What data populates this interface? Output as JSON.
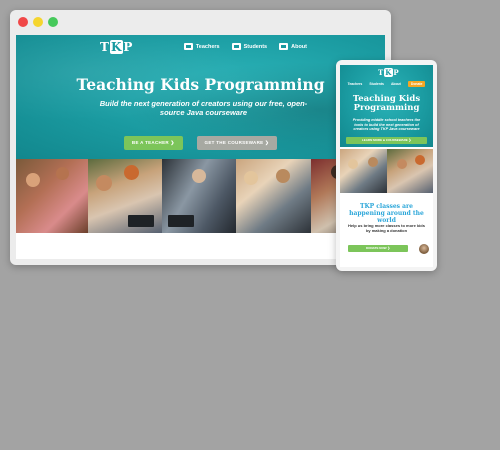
{
  "window": {
    "controls": [
      "close",
      "minimize",
      "zoom"
    ]
  },
  "desktop": {
    "logo": {
      "left": "T",
      "mid": "K",
      "right": "P"
    },
    "nav": [
      {
        "label": "Teachers",
        "icon": "teacher-icon"
      },
      {
        "label": "Students",
        "icon": "student-icon"
      },
      {
        "label": "About",
        "icon": "about-icon"
      }
    ],
    "hero": {
      "title": "Teaching Kids Programming",
      "subtitle": "Build the next generation of creators using our free, open-source Java courseware",
      "primary_button": "BE A TEACHER ❯",
      "secondary_button": "GET THE COURSEWARE ❯"
    }
  },
  "mobile": {
    "logo": {
      "left": "T",
      "mid": "K",
      "right": "P"
    },
    "nav": [
      "Teachers",
      "Students",
      "About",
      "Donate"
    ],
    "hero": {
      "title": "Teaching Kids Programming",
      "subtitle": "Providing middle school teachers the tools to build the next generation of creators using TKP Java courseware",
      "button": "LEARN MORE & COURSEWARE ❯"
    },
    "section": {
      "title": "TKP classes are happening around the world",
      "text": "Help us bring more classes to more kids by making a donation",
      "button": "DONATE NOW ❯"
    }
  },
  "colors": {
    "brand_teal": "#1a9aa0",
    "accent_green": "#7cc55a",
    "heading_blue": "#2ba6d9",
    "background": "#a3a3a3"
  }
}
